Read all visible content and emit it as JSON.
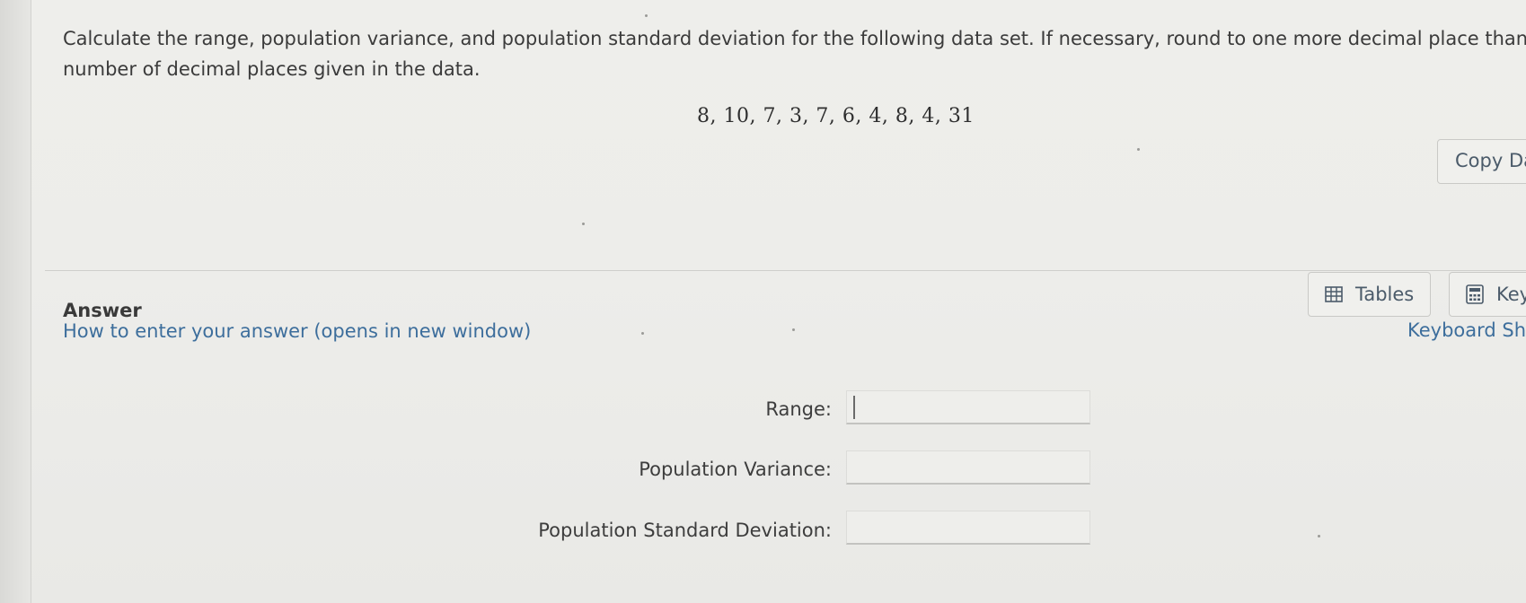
{
  "question": {
    "line1": "Calculate the range, population variance, and population standard deviation for the following data set. If necessary, round to one more decimal place than the largest",
    "line2": "number of decimal places given in the data."
  },
  "dataset": "8, 10, 7, 3, 7, 6, 4, 8, 4, 31",
  "copy_button_label": "Copy Data",
  "answer": {
    "heading": "Answer",
    "help_link": "How to enter your answer (opens in new window)",
    "tables_label": "Tables",
    "keypad_label": "Keypad",
    "shortcuts_label": "Keyboard Shortcuts"
  },
  "fields": {
    "range_label": "Range:",
    "range_value": "",
    "variance_label": "Population Variance:",
    "variance_value": "",
    "sd_label": "Population Standard Deviation:",
    "sd_value": ""
  },
  "icons": {
    "tables": "table-grid-icon",
    "keypad": "calculator-icon"
  },
  "colors": {
    "link": "#3d6e9c",
    "text": "#3d3d3d",
    "background": "#ededea"
  }
}
